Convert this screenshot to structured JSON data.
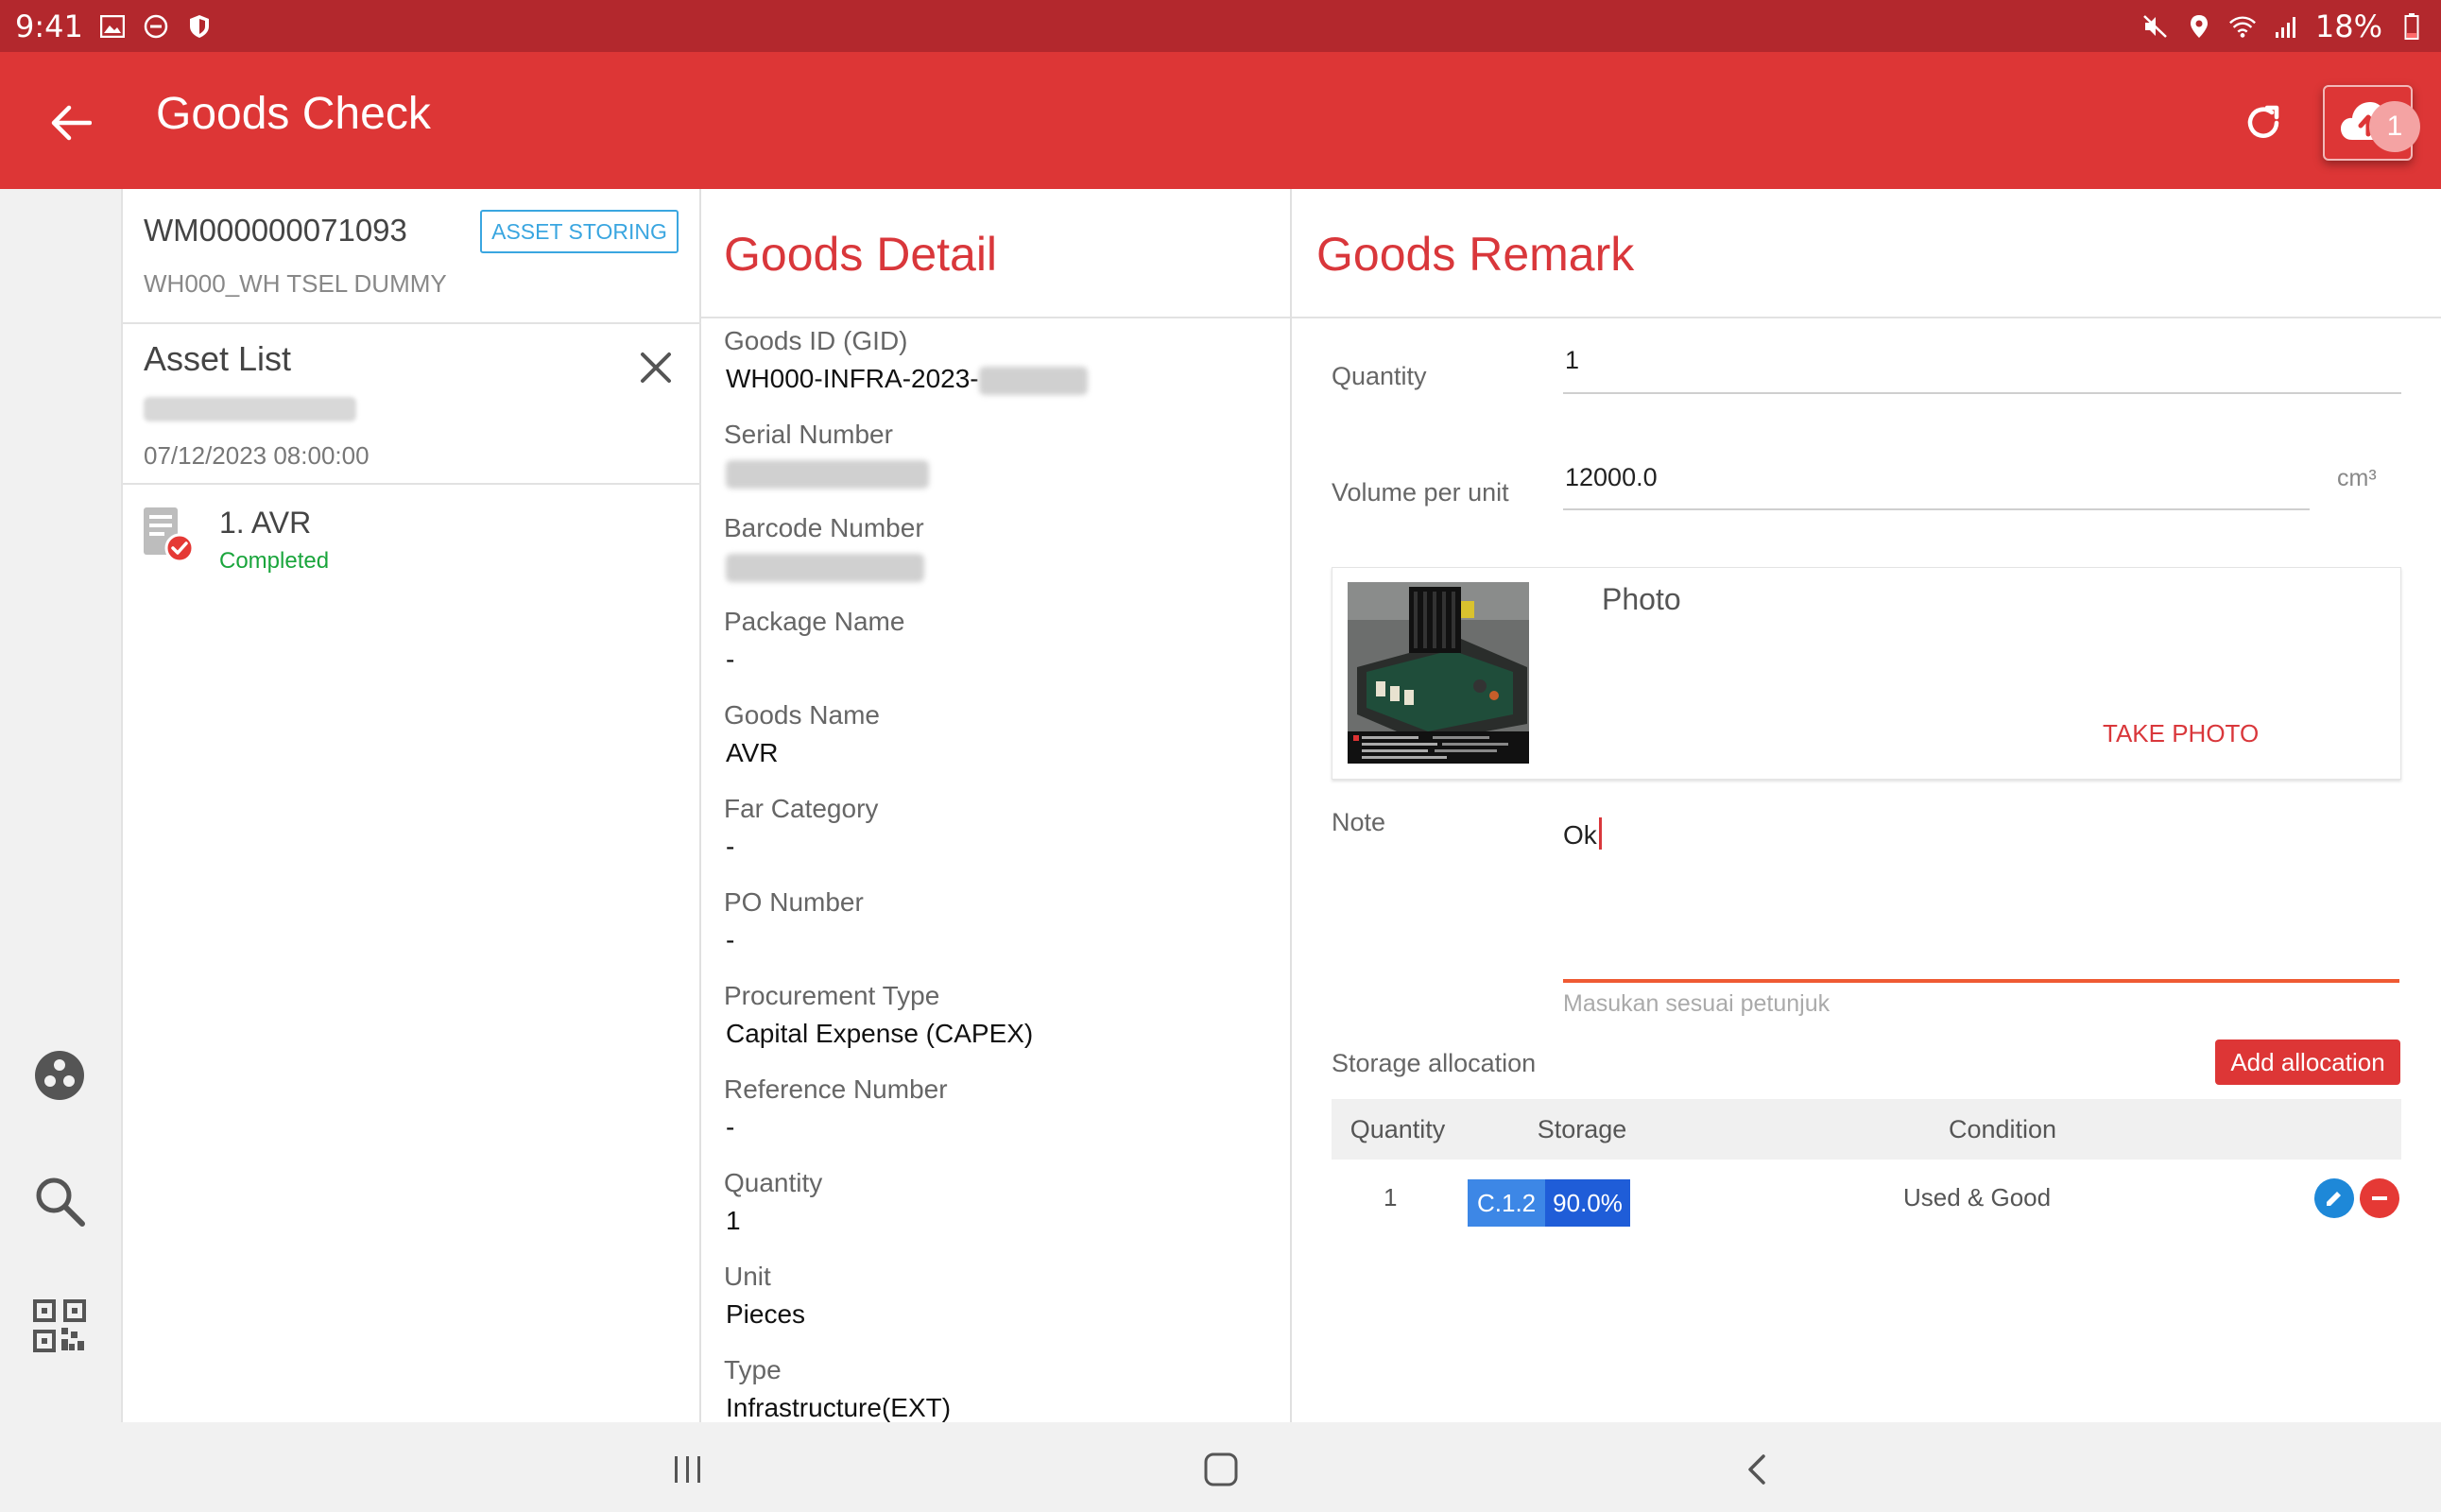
{
  "status_bar": {
    "time": "9:41",
    "battery": "18%"
  },
  "app_bar": {
    "title": "Goods Check",
    "upload_badge": "1"
  },
  "sidebar_rail": {
    "icons": [
      "cluster-icon",
      "search-icon",
      "qr-code-icon"
    ]
  },
  "document": {
    "code": "WM000000071093",
    "warehouse": "WH000_WH TSEL DUMMY",
    "tag": "ASSET STORING"
  },
  "asset_list": {
    "title": "Asset List",
    "date": "07/12/2023 08:00:00",
    "items": [
      {
        "name": "1. AVR",
        "status": "Completed"
      }
    ]
  },
  "goods_detail": {
    "title": "Goods Detail",
    "fields": [
      {
        "label": "Goods ID (GID)",
        "value": "WH000-INFRA-2023-"
      },
      {
        "label": "Serial Number",
        "value": ""
      },
      {
        "label": "Barcode Number",
        "value": ""
      },
      {
        "label": "Package Name",
        "value": "-"
      },
      {
        "label": "Goods Name",
        "value": "AVR"
      },
      {
        "label": "Far Category",
        "value": "-"
      },
      {
        "label": "PO Number",
        "value": "-"
      },
      {
        "label": "Procurement Type",
        "value": "Capital Expense (CAPEX)"
      },
      {
        "label": "Reference Number",
        "value": "-"
      },
      {
        "label": "Quantity",
        "value": "1"
      },
      {
        "label": "Unit",
        "value": "Pieces"
      },
      {
        "label": "Type",
        "value": "Infrastructure(EXT)"
      }
    ]
  },
  "goods_remark": {
    "title": "Goods Remark",
    "quantity_label": "Quantity",
    "quantity_value": "1",
    "volume_label": "Volume per unit",
    "volume_value": "12000.0",
    "volume_unit": "cm³",
    "photo_label": "Photo",
    "take_photo": "TAKE PHOTO",
    "note_label": "Note",
    "note_value": "Ok",
    "note_hint": "Masukan sesuai petunjuk",
    "storage_label": "Storage allocation",
    "add_allocation": "Add allocation",
    "table": {
      "headers": [
        "Quantity",
        "Storage",
        "Condition"
      ],
      "rows": [
        {
          "quantity": "1",
          "storage_code": "C.1.2",
          "storage_pct": "90.0%",
          "condition": "Used & Good"
        }
      ]
    }
  },
  "colors": {
    "brand": "#dd3636",
    "status_bar": "#b3282d",
    "accent_blue": "#3aa6e0",
    "completed": "#1aa53c"
  }
}
